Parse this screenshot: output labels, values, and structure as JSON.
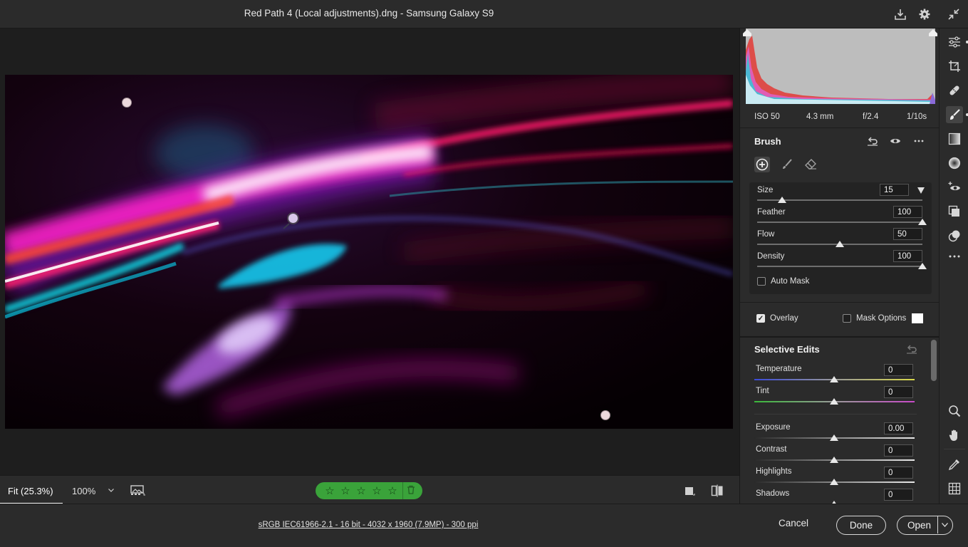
{
  "window": {
    "title": "Red Path 4 (Local adjustments).dng  -  Samsung Galaxy S9"
  },
  "header_icons": [
    "save-icon",
    "settings-icon",
    "collapse-icon"
  ],
  "zoom": {
    "fit_label": "Fit (25.3%)",
    "percent_label": "100%"
  },
  "rating": {
    "stars": 0,
    "max": 5
  },
  "file_info": "sRGB IEC61966-2.1 - 16 bit - 4032 x 1960 (7.9MP) - 300 ppi",
  "footer": {
    "cancel": "Cancel",
    "done": "Done",
    "open": "Open"
  },
  "exif": {
    "iso": "ISO 50",
    "focal": "4.3 mm",
    "aperture": "f/2.4",
    "shutter": "1/10s"
  },
  "brush": {
    "title": "Brush",
    "size_label": "Size",
    "size_value": "15",
    "size_level": 0.15,
    "feather_label": "Feather",
    "feather_value": "100",
    "feather_level": 1.0,
    "flow_label": "Flow",
    "flow_value": "50",
    "flow_level": 0.5,
    "density_label": "Density",
    "density_value": "100",
    "density_level": 1.0,
    "auto_mask_label": "Auto Mask",
    "auto_mask_checked": false,
    "overlay_label": "Overlay",
    "overlay_checked": true,
    "mask_options_label": "Mask Options"
  },
  "selective_edits": {
    "title": "Selective Edits",
    "temperature_label": "Temperature",
    "temperature_value": "0",
    "tint_label": "Tint",
    "tint_value": "0",
    "exposure_label": "Exposure",
    "exposure_value": "0.00",
    "contrast_label": "Contrast",
    "contrast_value": "0",
    "highlights_label": "Highlights",
    "highlights_value": "0",
    "shadows_label": "Shadows",
    "shadows_value": "0"
  },
  "tools": [
    "edit-icon",
    "crop-icon",
    "healing-icon",
    "brush-icon",
    "linear-gradient-icon",
    "radial-gradient-icon",
    "red-eye-icon",
    "presets-icon",
    "snapshots-icon",
    "more-icon",
    "zoom-icon",
    "hand-icon",
    "eyedropper-icon",
    "grid-icon"
  ],
  "colors": {
    "rating_green": "#3aa33a",
    "panel_bg": "#2b2b2b",
    "canvas_bg": "#1e1e1e"
  }
}
